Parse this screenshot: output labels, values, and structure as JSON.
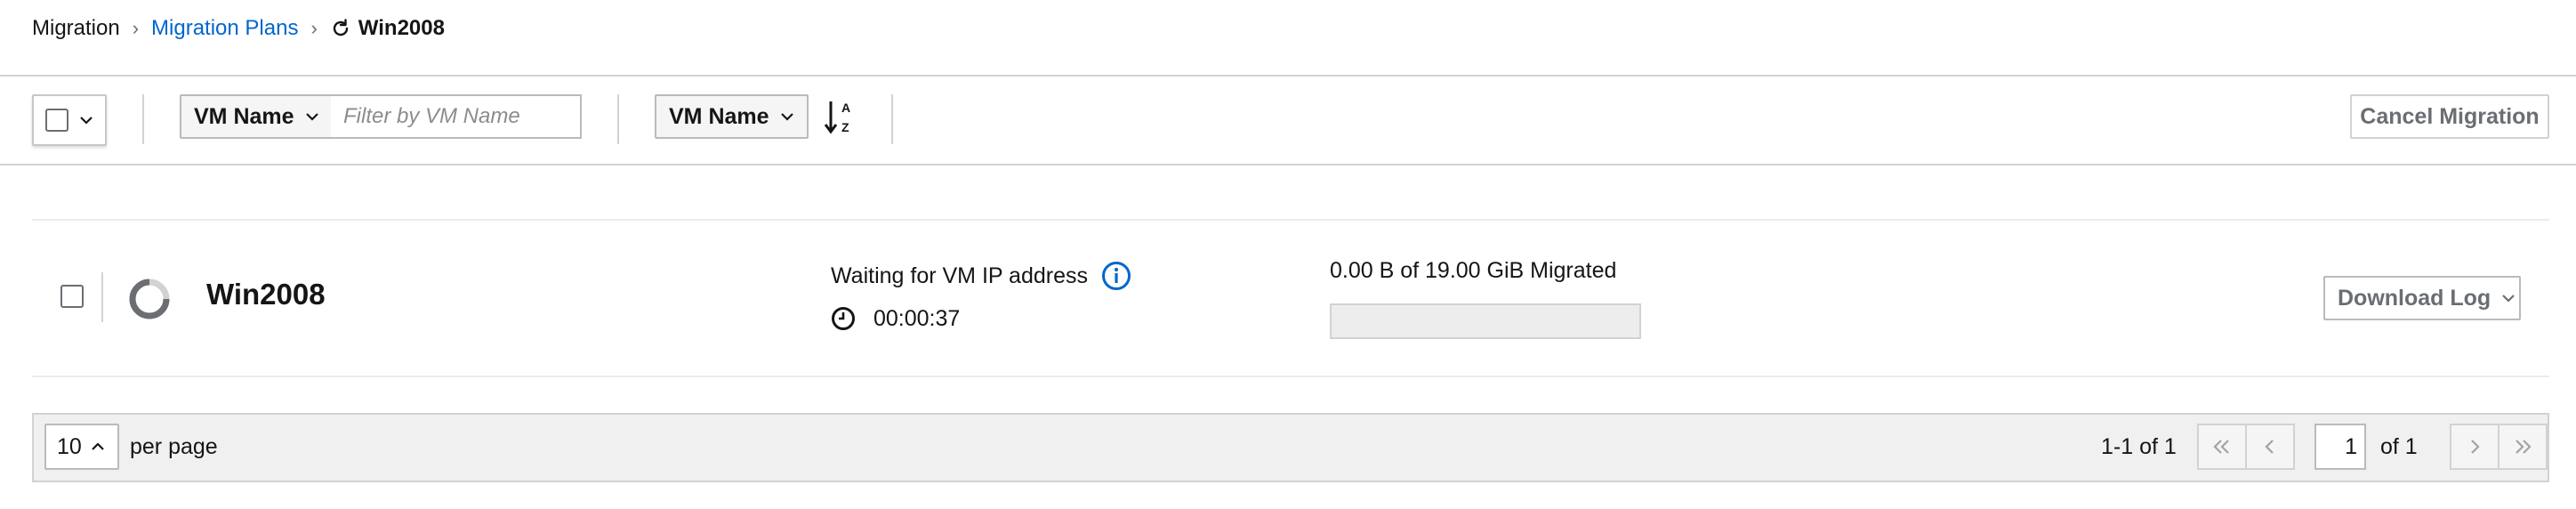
{
  "breadcrumb": {
    "root": "Migration",
    "plans": "Migration Plans",
    "current": "Win2008"
  },
  "toolbar": {
    "filter_select_label": "VM Name",
    "filter_placeholder": "Filter by VM Name",
    "sort_select_label": "VM Name",
    "sort_icon": "sort-alpha-down-icon",
    "cancel_label": "Cancel Migration"
  },
  "vm_row": {
    "name": "Win2008",
    "status_text": "Waiting for VM IP address",
    "elapsed": "00:00:37",
    "migrated_text": "0.00 B of 19.00 GiB Migrated",
    "progress_fraction": 0.0,
    "download_label": "Download Log"
  },
  "pagination": {
    "per_page_value": "10",
    "per_page_label": "per page",
    "range": "1-1 of 1",
    "page_value": "1",
    "of_pages": "of 1"
  },
  "colors": {
    "link": "#0066cc",
    "border": "#d2d2d2",
    "disabled_text": "#6a6e73",
    "pager_bg": "#f0f0f0"
  }
}
